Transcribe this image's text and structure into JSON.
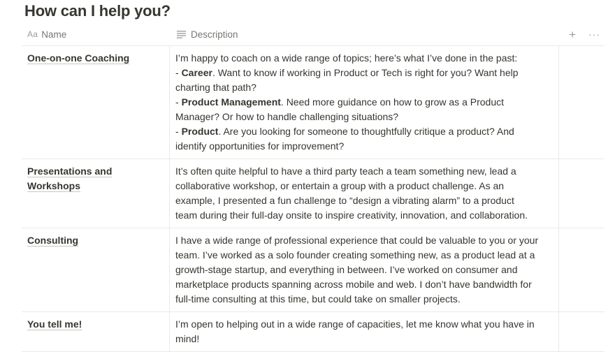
{
  "page": {
    "title": "How can I help you?"
  },
  "table": {
    "columns": {
      "name": {
        "icon": "Aa",
        "label": "Name"
      },
      "description": {
        "icon": "lines-icon",
        "label": "Description"
      }
    },
    "actions": {
      "add": "+",
      "more": "···"
    },
    "rows": [
      {
        "name": "One-on-one Coaching",
        "lines": [
          {
            "text": "I’m happy to coach on a wide range of topics; here’s what I’ve done in the past:"
          },
          {
            "prefix": "- ",
            "bold": "Career",
            "text": ". Want to know if working in Product or Tech is right for you? Want help"
          },
          {
            "text": "charting that path?"
          },
          {
            "prefix": "- ",
            "bold": "Product Management",
            "text": ". Need more guidance on how to grow as a Product"
          },
          {
            "text": "Manager? Or how to handle challenging situations?"
          },
          {
            "prefix": "- ",
            "bold": "Product",
            "text": ". Are you looking for someone to thoughtfully critique a product? And"
          },
          {
            "text": "identify opportunities for improvement?"
          }
        ]
      },
      {
        "name": "Presentations and Workshops",
        "lines": [
          {
            "text": "It’s often quite helpful to have a third party teach a team something new, lead a"
          },
          {
            "text": "collaborative workshop, or entertain a group with a product challenge. As an"
          },
          {
            "text": "example, I presented a fun challenge to “design a vibrating alarm” to a product"
          },
          {
            "text": "team during their full-day onsite to inspire creativity, innovation, and collaboration."
          }
        ]
      },
      {
        "name": "Consulting",
        "lines": [
          {
            "text": "I have a wide range of professional experience that could be valuable to you or your"
          },
          {
            "text": "team. I’ve worked as a solo founder creating something new, as a product lead at a"
          },
          {
            "text": "growth-stage startup, and everything in between. I’ve worked on consumer and"
          },
          {
            "text": "marketplace products spanning across mobile and web. I don’t have bandwidth for"
          },
          {
            "text": "full-time consulting at this time, but could take on smaller projects."
          }
        ]
      },
      {
        "name": "You tell me!",
        "lines": [
          {
            "text": "I’m open to helping out in a wide range of capacities, let me know what you have in"
          },
          {
            "text": "mind!"
          }
        ]
      }
    ]
  }
}
